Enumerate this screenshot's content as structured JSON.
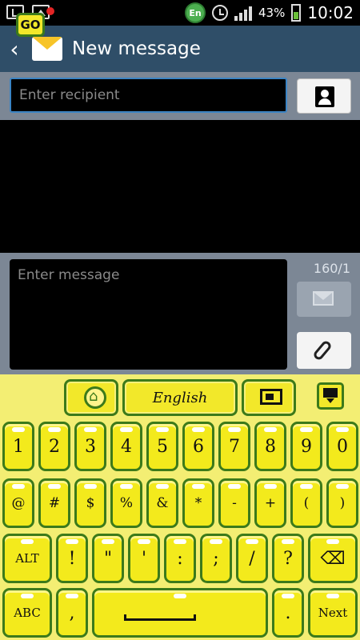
{
  "status_bar": {
    "language_badge": "En",
    "battery_percent": "43%",
    "time": "10:02",
    "icons": [
      "usb-icon",
      "picture-icon",
      "alarm-icon",
      "signal-icon",
      "battery-icon"
    ]
  },
  "app_bar": {
    "title": "New message"
  },
  "recipient": {
    "placeholder": "Enter recipient"
  },
  "compose": {
    "placeholder": "Enter message",
    "counter": "160/1"
  },
  "keyboard": {
    "go_label": "GO",
    "language": "English",
    "row1": [
      "1",
      "2",
      "3",
      "4",
      "5",
      "6",
      "7",
      "8",
      "9",
      "0"
    ],
    "row2": [
      "@",
      "#",
      "$",
      "%",
      "&",
      "*",
      "-",
      "+",
      "(",
      ")"
    ],
    "row3": [
      "ALT",
      "!",
      "\"",
      "'",
      ":",
      ";",
      "/",
      "?"
    ],
    "row4": {
      "abc": "ABC",
      "comma": ",",
      "period": ".",
      "next": "Next"
    }
  },
  "colors": {
    "app_bar": "#2f4e68",
    "input_border": "#3b84c4",
    "keyboard_bg": "#f3ee73",
    "key_fill": "#f3ea1c",
    "key_border": "#3c7a1a"
  }
}
